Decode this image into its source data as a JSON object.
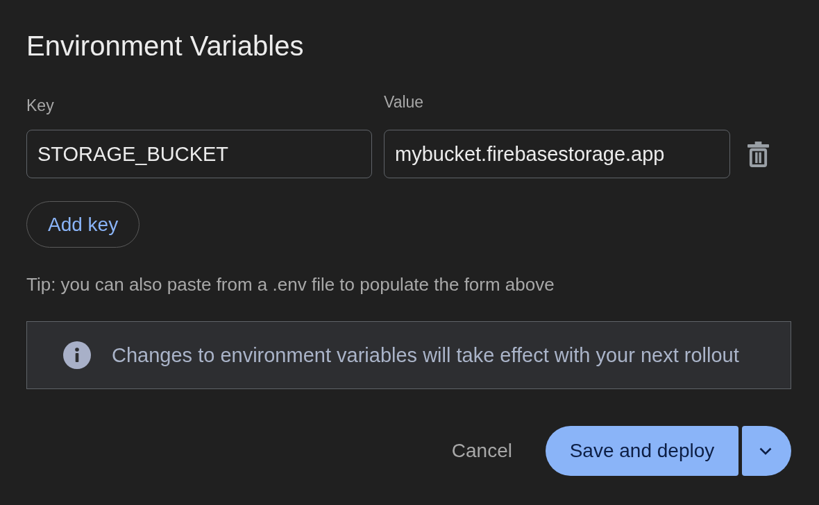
{
  "dialog": {
    "title": "Environment Variables",
    "columns": [
      "Key",
      "Value"
    ],
    "rows": [
      {
        "key": "STORAGE_BUCKET",
        "value": "mybucket.firebasestorage.app"
      }
    ],
    "add_button": "Add key",
    "tip": "Tip: you can also paste from a .env file to populate the form above",
    "notice": {
      "text": "Changes to environment variables will take effect with your next rollout"
    },
    "actions": {
      "cancel": "Cancel",
      "primary": "Save and deploy"
    }
  }
}
